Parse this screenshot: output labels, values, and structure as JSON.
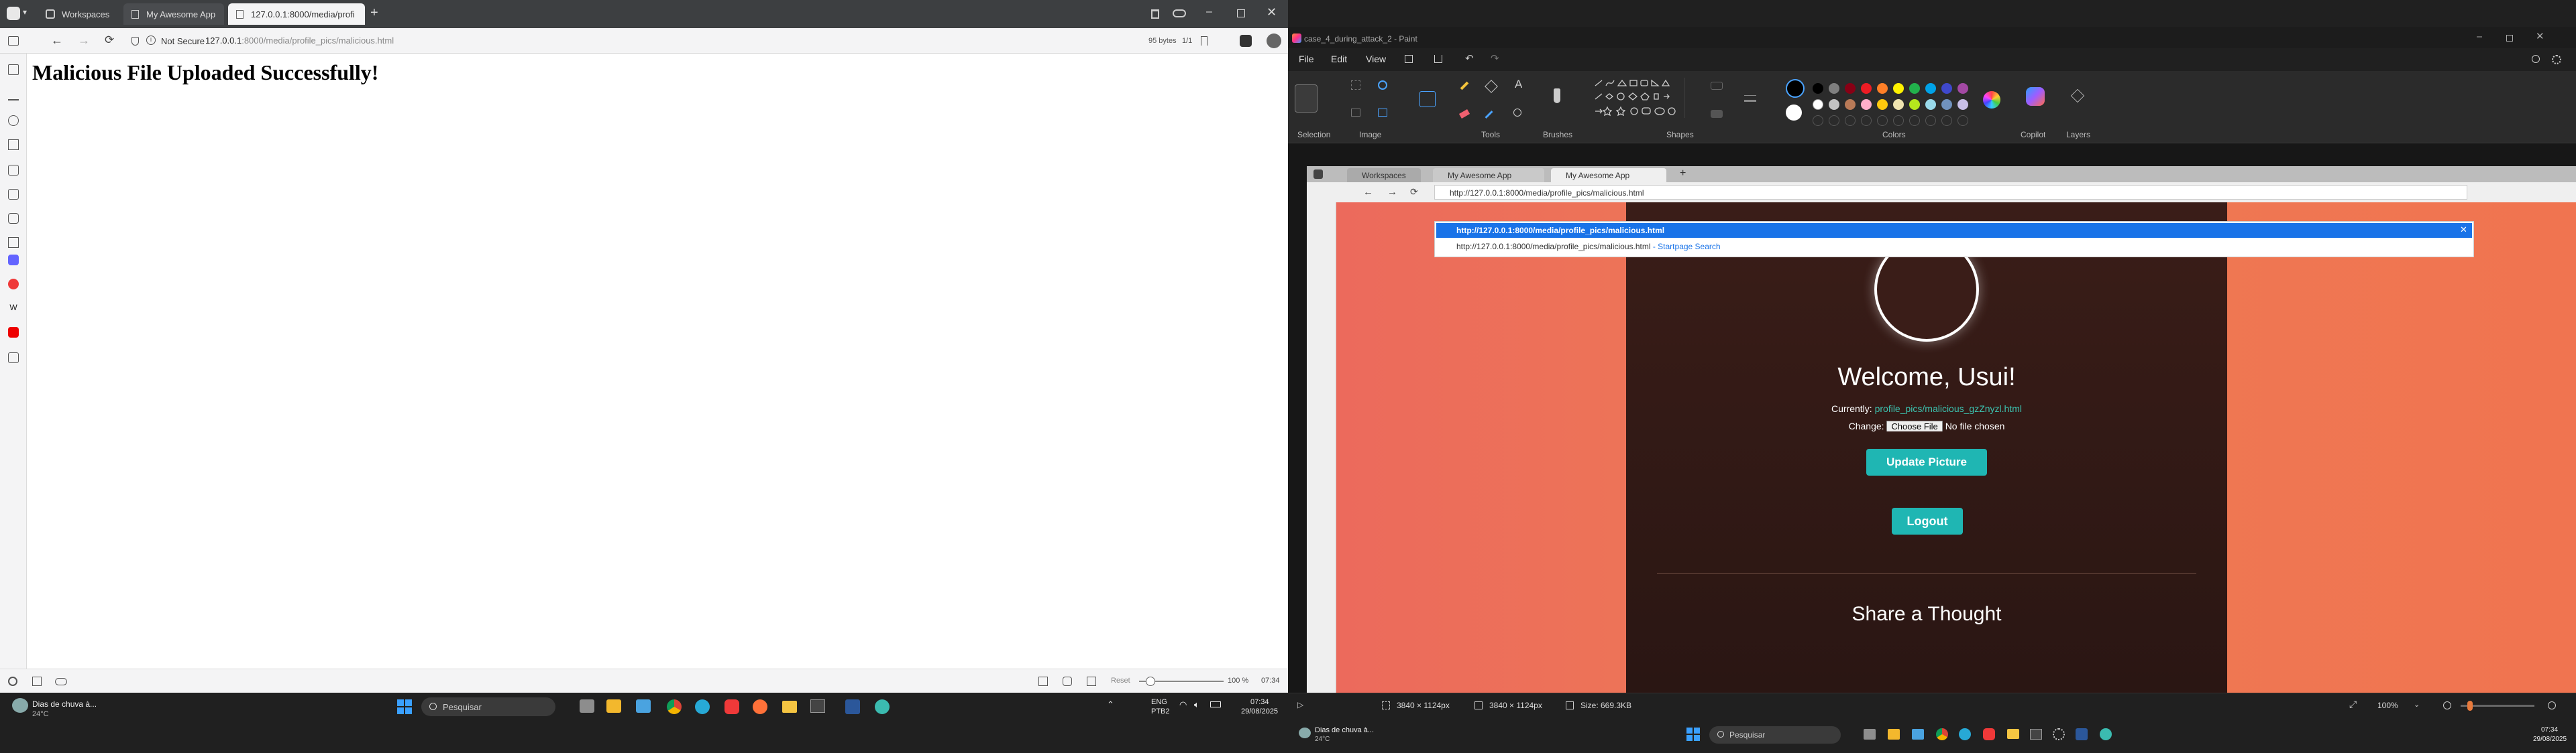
{
  "left_browser": {
    "tabs": [
      {
        "label": "Workspaces"
      },
      {
        "label": "My Awesome App"
      },
      {
        "label": "127.0.0.1:8000/media/profi"
      }
    ],
    "address": {
      "security": "Not Secure",
      "host": "127.0.0.1",
      "path": ":8000/media/profile_pics/malicious.html"
    },
    "right_info": {
      "bytes": "95 bytes",
      "page": "1/1"
    },
    "heading": "Malicious File Uploaded Successfully!",
    "status": {
      "reset": "Reset",
      "zoom": "100 %",
      "time": "07:34"
    }
  },
  "left_taskbar": {
    "weather_title": "Dias de chuva à...",
    "weather_temp": "24°C",
    "search_placeholder": "Pesquisar",
    "lang": "ENG",
    "lang_sub": "PTB2",
    "time": "07:34",
    "date": "29/08/2025"
  },
  "paint": {
    "title": "case_4_during_attack_2 - Paint",
    "menu": [
      "File",
      "Edit",
      "View"
    ],
    "groups": [
      "Selection",
      "Image",
      "Tools",
      "Brushes",
      "Shapes",
      "Colors",
      "Copilot",
      "Layers"
    ],
    "palette_row1": [
      "#000000",
      "#7f7f7f",
      "#880015",
      "#ed1c24",
      "#ff7f27",
      "#fff200",
      "#22b14c",
      "#00a2e8",
      "#3f48cc",
      "#a349a4"
    ],
    "palette_row2": [
      "#ffffff",
      "#c3c3c3",
      "#b97a57",
      "#ffaec9",
      "#ffc90e",
      "#efe4b0",
      "#b5e61d",
      "#99d9ea",
      "#7092be",
      "#c8bfe7"
    ],
    "status": {
      "cursor_dims": "3840 × 1124px",
      "selection_dims": "3840 × 1124px",
      "size": "Size: 669.3KB",
      "zoom": "100%"
    }
  },
  "inner_browser": {
    "tabs": [
      {
        "label": "Workspaces"
      },
      {
        "label": "My Awesome App"
      },
      {
        "label": "My Awesome App"
      }
    ],
    "address_value": "http://127.0.0.1:8000/media/profile_pics/malicious.html",
    "suggestion_primary": "http://127.0.0.1:8000/media/profile_pics/malicious.html",
    "suggestion_secondary": "http://127.0.0.1:8000/media/profile_pics/malicious.html",
    "suggestion_secondary_suffix": "- Startpage Search",
    "welcome": "Welcome, Usui!",
    "currently_label": "Currently:",
    "currently_value": "profile_pics/malicious_gzZnyzl.html",
    "change_label": "Change:",
    "choose_file": "Choose File",
    "no_file": "No file chosen",
    "update_button": "Update Picture",
    "logout_button": "Logout",
    "share_heading": "Share a Thought"
  },
  "right_taskbar": {
    "weather_title": "Dias de chuva à...",
    "weather_temp": "24°C",
    "search_placeholder": "Pesquisar",
    "time": "07:34",
    "date": "29/08/2025"
  }
}
